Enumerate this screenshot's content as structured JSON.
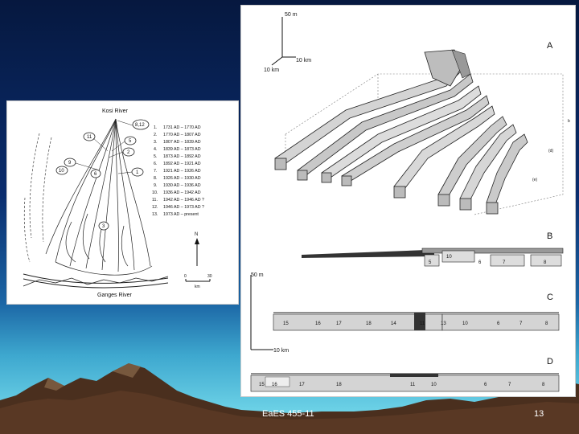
{
  "footer": {
    "course": "EaES 455-11",
    "page": "13"
  },
  "map": {
    "river_top": "Kosi River",
    "river_bottom": "Ganges River",
    "north": "N",
    "scale_min": "0",
    "scale_max": "30",
    "scale_unit": "km",
    "legend": [
      {
        "num": "1.",
        "range": "1731 AD  –  1770 AD"
      },
      {
        "num": "2.",
        "range": "1770 AD  –  1807 AD"
      },
      {
        "num": "3.",
        "range": "1807 AD  –  1839 AD"
      },
      {
        "num": "4.",
        "range": "1839 AD  –  1873 AD"
      },
      {
        "num": "5.",
        "range": "1873 AD  –  1892 AD"
      },
      {
        "num": "6.",
        "range": "1892 AD  –  1921 AD"
      },
      {
        "num": "7.",
        "range": "1921 AD  –  1926 AD"
      },
      {
        "num": "8.",
        "range": "1926 AD  –  1930 AD"
      },
      {
        "num": "9.",
        "range": "1930 AD  –  1936 AD"
      },
      {
        "num": "10.",
        "range": "1936 AD  –  1942 AD"
      },
      {
        "num": "11.",
        "range": "1942 AD  –  1946 AD ?"
      },
      {
        "num": "12.",
        "range": "1946 AD  –  1973 AD ?"
      },
      {
        "num": "13.",
        "range": "1973 AD  –  present"
      }
    ],
    "callouts": [
      "8,12",
      "11",
      "5",
      "2",
      "1",
      "9",
      "10",
      "6",
      "3"
    ]
  },
  "sections": {
    "A": "A",
    "B": "B",
    "C": "C",
    "D": "D",
    "scale_vertical_top": "50 m",
    "scale_horizontal_top": "10 km",
    "scale_depth_top": "10 km",
    "scale_vertical_mid": "50 m",
    "scale_horizontal_mid": "10 km",
    "block_side_labels": [
      "b",
      "(d)",
      "(e)"
    ],
    "b_labels": [
      "5",
      "10",
      "6",
      "7",
      "8"
    ],
    "c_labels": [
      "15",
      "16",
      "17",
      "18",
      "14",
      "11",
      "13",
      "10",
      "6",
      "7",
      "8"
    ],
    "d_labels": [
      "15",
      "16",
      "17",
      "18",
      "11",
      "10",
      "6",
      "7",
      "8"
    ]
  },
  "colors": {
    "accent": "#ffffff",
    "ground": "#4a2f1e"
  }
}
